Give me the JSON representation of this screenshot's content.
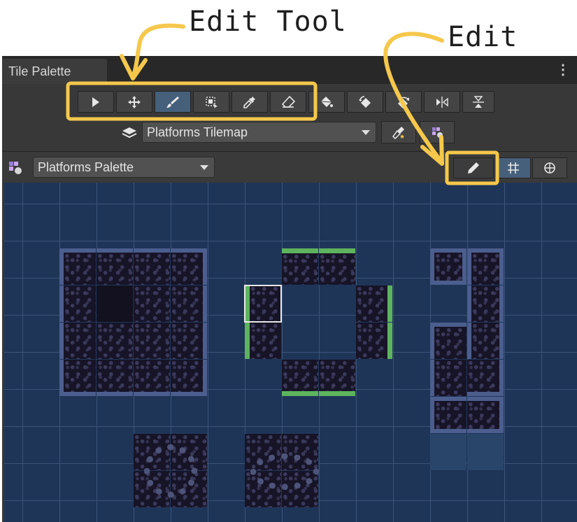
{
  "annotations": {
    "edit_tool": "Edit Tool",
    "edit": "Edit"
  },
  "window": {
    "tab_title": "Tile Palette",
    "menu_icon": "kebab-menu-icon"
  },
  "toolbar": {
    "tools": [
      {
        "name": "select",
        "icon": "select-arrow-icon",
        "active": false
      },
      {
        "name": "move",
        "icon": "move-icon",
        "active": false
      },
      {
        "name": "paint",
        "icon": "brush-icon",
        "active": true
      },
      {
        "name": "box-fill",
        "icon": "box-fill-icon",
        "active": false
      },
      {
        "name": "pick",
        "icon": "eyedropper-icon",
        "active": false
      },
      {
        "name": "erase",
        "icon": "eraser-icon",
        "active": false
      },
      {
        "name": "fill",
        "icon": "paint-bucket-icon",
        "active": false
      },
      {
        "name": "rotate-ccw",
        "icon": "rotate-ccw-icon",
        "active": false
      },
      {
        "name": "rotate-cw",
        "icon": "rotate-cw-icon",
        "active": false
      },
      {
        "name": "flip-x",
        "icon": "flip-horizontal-icon",
        "active": false
      },
      {
        "name": "flip-y",
        "icon": "flip-vertical-icon",
        "active": false
      }
    ]
  },
  "tilemap": {
    "selected": "Platforms Tilemap"
  },
  "palette": {
    "selected": "Platforms Palette",
    "edit_button_icon": "pencil-icon",
    "grid_button_icon": "grid-icon",
    "gizmo_button_icon": "gizmo-icon"
  },
  "colors": {
    "highlight": "#F5C84C",
    "active_button": "#46607C",
    "grid_bg": "#1E3558",
    "grass": "#5DB35E"
  }
}
